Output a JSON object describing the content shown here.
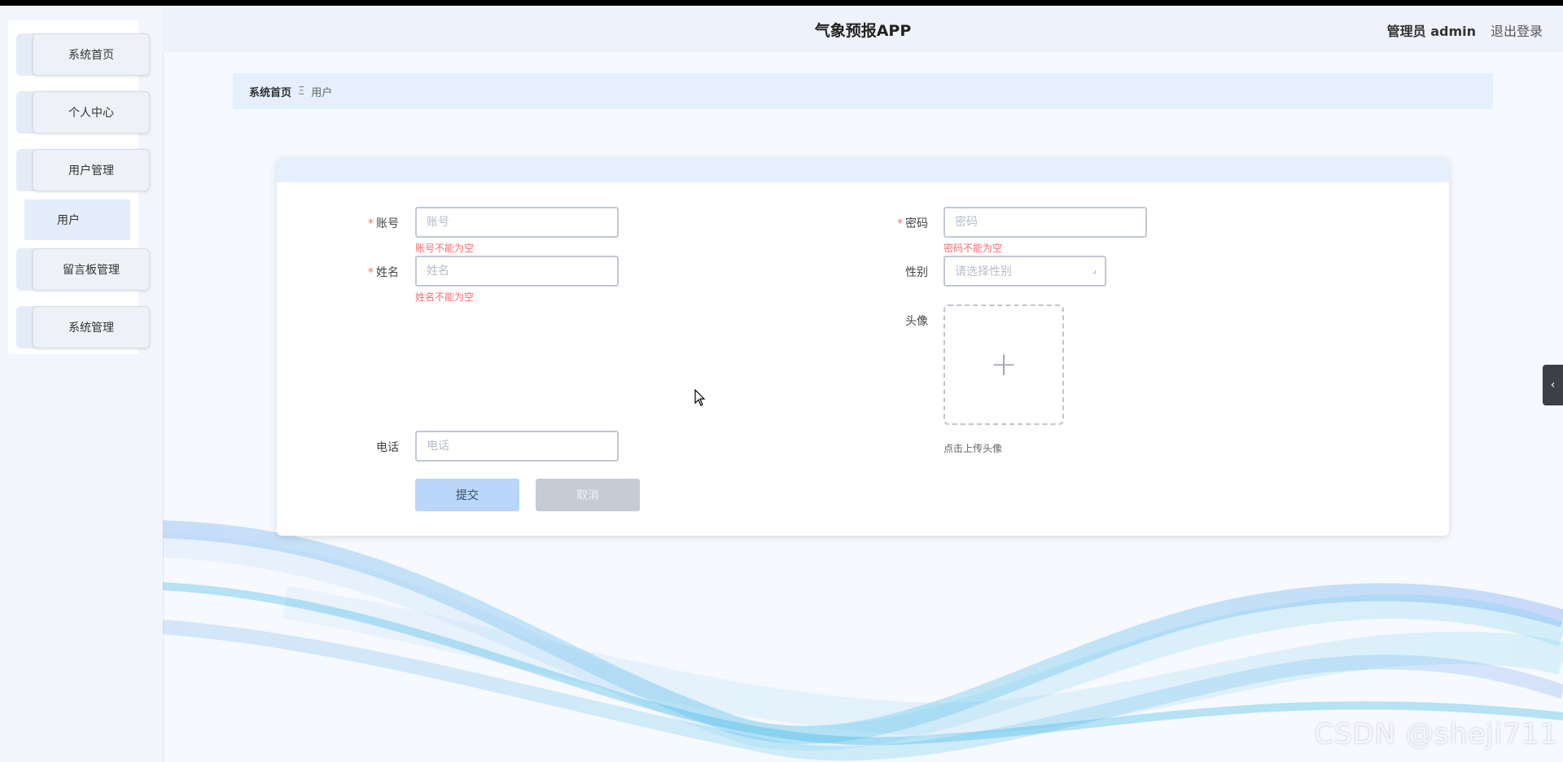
{
  "header": {
    "title": "气象预报APP",
    "admin_label": "管理员 admin",
    "logout_label": "退出登录"
  },
  "sidebar": {
    "items": [
      {
        "label": "系统首页"
      },
      {
        "label": "个人中心"
      },
      {
        "label": "用户管理"
      },
      {
        "label": "留言板管理"
      },
      {
        "label": "系统管理"
      }
    ],
    "submenu": {
      "label": "用户"
    }
  },
  "breadcrumb": {
    "home": "系统首页",
    "separator": "Ξ",
    "current": "用户"
  },
  "form": {
    "account": {
      "label": "账号",
      "placeholder": "账号",
      "error": "账号不能为空"
    },
    "password": {
      "label": "密码",
      "placeholder": "密码",
      "error": "密码不能为空"
    },
    "name": {
      "label": "姓名",
      "placeholder": "姓名",
      "error": "姓名不能为空"
    },
    "gender": {
      "label": "性别",
      "placeholder": "请选择性别"
    },
    "avatar": {
      "label": "头像",
      "hint": "点击上传头像"
    },
    "phone": {
      "label": "电话",
      "placeholder": "电话"
    },
    "required_mark": "*",
    "submit_label": "提交",
    "cancel_label": "取消"
  },
  "watermark": "CSDN @sheji711",
  "colors": {
    "accent": "#b9d6fb",
    "error": "#f56c6c",
    "sidebar_bg": "#f2f6fc",
    "header_bg": "#eef3fb"
  }
}
